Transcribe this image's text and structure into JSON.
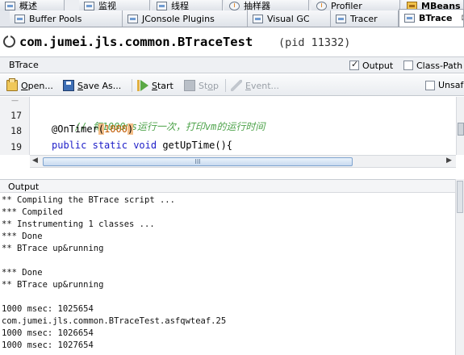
{
  "tabs_top": [
    {
      "label": "概述",
      "icon": "overview-icon"
    },
    {
      "label": "监视",
      "icon": "monitor-icon"
    },
    {
      "label": "线程",
      "icon": "threads-icon"
    },
    {
      "label": "抽样器",
      "icon": "sampler-icon"
    },
    {
      "label": "Profiler",
      "icon": "profiler-icon"
    },
    {
      "label": "MBeans",
      "icon": "mbeans-icon"
    }
  ],
  "tabs_plugins": [
    {
      "label": "Buffer Pools",
      "icon": "buffer-pools-icon"
    },
    {
      "label": "JConsole Plugins",
      "icon": "jconsole-plugins-icon"
    },
    {
      "label": "Visual GC",
      "icon": "visual-gc-icon"
    },
    {
      "label": "Tracer",
      "icon": "tracer-icon"
    },
    {
      "label": "BTrace",
      "icon": "btrace-icon",
      "close": "⊠"
    }
  ],
  "title": {
    "main": "com.jumei.jls.common.BTraceTest",
    "pid": "(pid 11332)"
  },
  "panel": {
    "title": "BTrace",
    "output_label": "Output",
    "output_checked": true,
    "classpath_label": "Class-Path",
    "classpath_checked": false
  },
  "toolbar": {
    "open": {
      "label": "Open...",
      "underline": "O",
      "rest": "pen..."
    },
    "save": {
      "label": "Save As...",
      "underline": "S",
      "rest": "ave As..."
    },
    "start": {
      "label": "Start",
      "underline": "S",
      "rest": "tart"
    },
    "stop": {
      "label": "Stop",
      "first": "St",
      "underline": "o",
      "rest": "p"
    },
    "event": {
      "label": "Event...",
      "underline": "E",
      "rest": "vent..."
    },
    "unsafe": {
      "label": "Unsafe",
      "checked": false
    }
  },
  "editor": {
    "line_numbers": [
      "17",
      "18",
      "19"
    ],
    "line17": {
      "comment": "// 每1000ms运行一次，打印vm的运行时间"
    },
    "line18": {
      "annotation": "@OnTimer",
      "open": "(",
      "number": "1000",
      "close": ")"
    },
    "line19": {
      "kw1": "public",
      "kw2": "static",
      "kw3": "void",
      "rest": " getUpTime(){"
    }
  },
  "hscroll": {
    "left_arrow": "◀",
    "right_arrow": "▶",
    "grip": "III"
  },
  "output": {
    "title": "Output",
    "lines": [
      "** Compiling the BTrace script ...",
      "*** Compiled",
      "** Instrumenting 1 classes ...",
      "*** Done",
      "** BTrace up&running",
      "",
      "*** Done",
      "** BTrace up&running",
      "",
      "1000 msec: 1025654",
      "com.jumei.jls.common.BTraceTest.asfqwteaf.25",
      "1000 msec: 1026654",
      "1000 msec: 1027654"
    ]
  },
  "colors": {
    "comment": "#4da34a",
    "keyword": "#1d1dc8",
    "number": "#c25a00",
    "bracket_highlight": "#f5c08a"
  }
}
